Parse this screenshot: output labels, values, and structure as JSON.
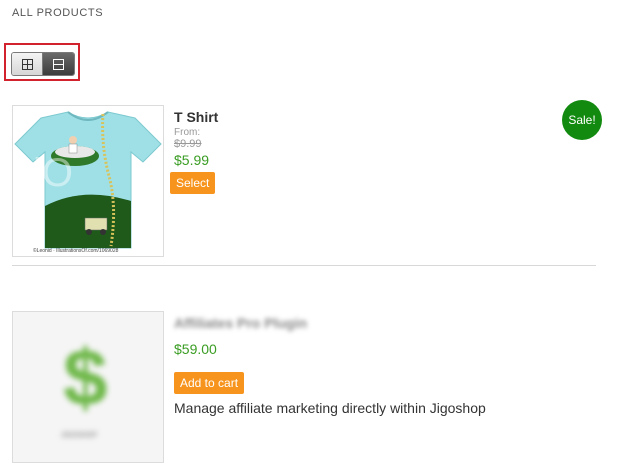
{
  "section": {
    "title": "ALL PRODUCTS"
  },
  "view_toggle": {
    "grid_icon": "grid-view-icon",
    "list_icon": "list-view-icon",
    "active": "list"
  },
  "products": [
    {
      "title": "T Shirt",
      "from_label": "From:",
      "old_price": "$9.99",
      "price": "$5.99",
      "button_label": "Select",
      "badge": "Sale!",
      "image_caption": "©Leonid · IllustrationsOf.com/1069028"
    },
    {
      "title": "Affiliates Pro Plugin",
      "price": "$59.00",
      "button_label": "Add to cart",
      "description": "Manage affiliate marketing directly within Jigoshop",
      "image_caption": "JIGOSHOP"
    }
  ],
  "colors": {
    "price_green": "#3a9d23",
    "button_orange": "#f7941d",
    "sale_badge": "#128a0f",
    "highlight_red": "#d2222d"
  }
}
